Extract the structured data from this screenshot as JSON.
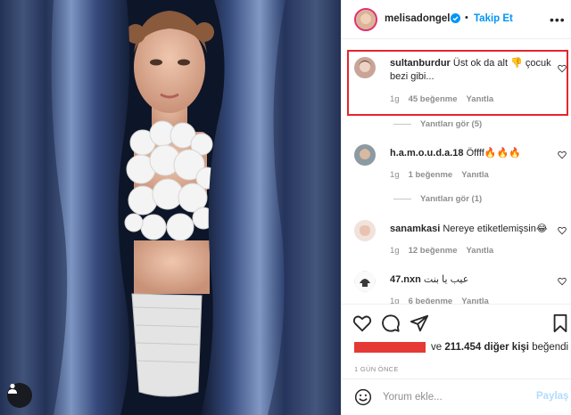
{
  "post": {
    "author": "melisadongel",
    "follow_label": "Takip Et",
    "more_label": "•••",
    "dot": "•"
  },
  "comments": [
    {
      "user": "sultanburdur",
      "text": "Üst ok da alt 👎 çocuk bezi gibi...",
      "time": "1g",
      "likes": "45 beğenme",
      "reply_label": "Yanıtla",
      "view_replies": "Yanıtları gör (5)"
    },
    {
      "user": "h.a.m.o.u.d.a.18",
      "text": "Öffff🔥🔥🔥",
      "time": "1g",
      "likes": "1 beğenme",
      "reply_label": "Yanıtla",
      "view_replies": "Yanıtları gör (1)"
    },
    {
      "user": "sanamkasi",
      "text": "Nereye etiketlemişsin😂",
      "time": "1g",
      "likes": "12 beğenme",
      "reply_label": "Yanıtla"
    },
    {
      "user": "47.nxn",
      "text": "عيب يا بنت",
      "time": "1g",
      "likes": "6 beğenme",
      "reply_label": "Yanıtla"
    }
  ],
  "likes_summary": {
    "prefix": "ve",
    "count_text": "211.454 diğer kişi",
    "suffix": "beğendi"
  },
  "timestamp": "1 GÜN ÖNCE",
  "add_comment": {
    "placeholder": "Yorum ekle...",
    "post_label": "Paylaş"
  },
  "colors": {
    "accent": "#0095f6",
    "highlight": "#e4262c",
    "redaction": "#e53935",
    "curtain": "#2c3f66"
  }
}
